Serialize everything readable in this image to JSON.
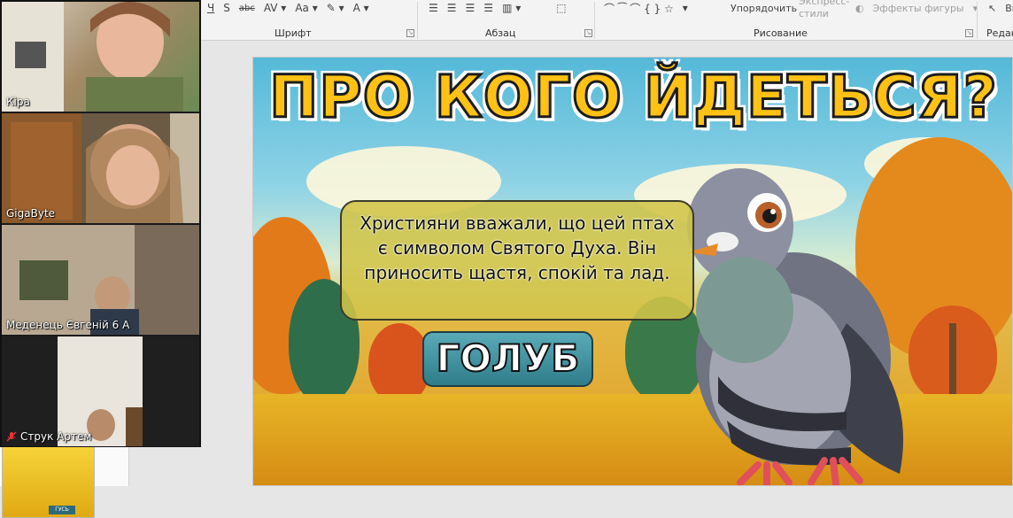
{
  "ribbon": {
    "font_group": "Шрифт",
    "paragraph_group": "Абзац",
    "drawing_group": "Рисование",
    "editing_group_partial": "Редак",
    "arrange_label": "Упорядочить",
    "express_styles_label": "Экспресс-\nстили",
    "shape_effects_label": "Эффекты фигуры",
    "select_partial": "Вы"
  },
  "slide": {
    "title": "ПРО КОГО ЙДЕТЬСЯ?",
    "text": "Християни вважали, що цей птах є символом Святого Духа. Він приносить щастя, спокій та лад.",
    "answer": "ГОЛУБ"
  },
  "participants": [
    {
      "name": "Кіра"
    },
    {
      "name": "GigaByte"
    },
    {
      "name": "Меденець Євгеній 6 А"
    },
    {
      "name": "Струк Артем",
      "muted": true
    }
  ],
  "thumbnail": {
    "button": "ГУСЬ"
  }
}
